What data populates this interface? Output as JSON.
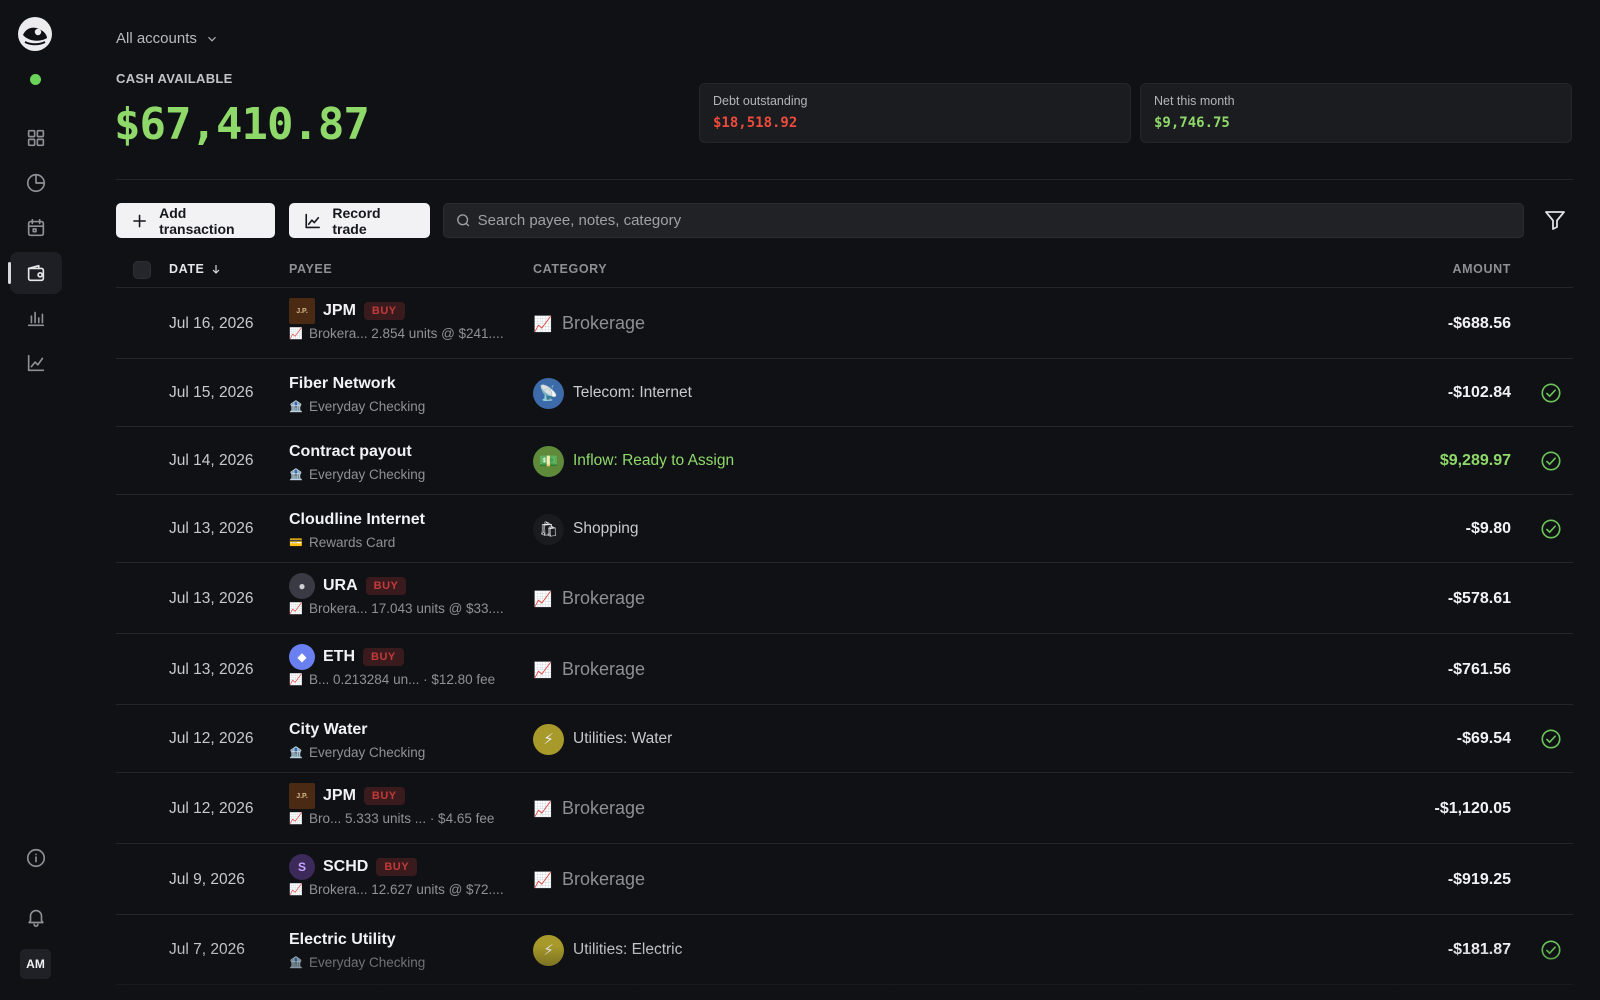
{
  "header": {
    "account_selector": "All accounts",
    "cash_label": "CASH AVAILABLE",
    "cash_value": "$67,410.87",
    "debt": {
      "label": "Debt outstanding",
      "value": "$18,518.92",
      "color": "#ef4b3c"
    },
    "net": {
      "label": "Net this month",
      "value": "$9,746.75",
      "color": "#8fd96a"
    }
  },
  "sidebar": {
    "status": "online",
    "items": [
      {
        "icon": "grid-icon"
      },
      {
        "icon": "pie-chart-icon"
      },
      {
        "icon": "calendar-icon"
      },
      {
        "icon": "wallet-icon",
        "active": true
      },
      {
        "icon": "bar-chart-icon"
      },
      {
        "icon": "line-chart-icon"
      }
    ],
    "bottom": [
      "info-icon",
      "bell-icon"
    ],
    "avatar": "AM"
  },
  "toolbar": {
    "add_label": "Add transaction",
    "trade_label": "Record trade",
    "search_placeholder": "Search payee, notes, category"
  },
  "table": {
    "headers": {
      "date": "DATE",
      "payee": "PAYEE",
      "category": "CATEGORY",
      "amount": "AMOUNT"
    },
    "rows": [
      {
        "date": "Jul 16, 2026",
        "payee": "JPM",
        "badge": "BUY",
        "sub_icon": "📈",
        "sub": "Brokera...  2.854 units @ $241....",
        "category": "Brokerage",
        "cat_icon": "📈",
        "amount": "-$688.56",
        "cleared": false
      },
      {
        "date": "Jul 15, 2026",
        "payee": "Fiber Network",
        "badge": "",
        "sub_icon": "🏦",
        "sub": "Everyday Checking",
        "category": "Telecom: Internet",
        "cat_icon": "📡",
        "amount": "-$102.84",
        "cleared": true
      },
      {
        "date": "Jul 14, 2026",
        "payee": "Contract payout",
        "badge": "",
        "sub_icon": "🏦",
        "sub": "Everyday Checking",
        "category": "Inflow: Ready to Assign",
        "cat_icon": "💵",
        "amount": "$9,289.97",
        "cleared": true
      },
      {
        "date": "Jul 13, 2026",
        "payee": "Cloudline Internet",
        "badge": "",
        "sub_icon": "💳",
        "sub": "Rewards Card",
        "category": "Shopping",
        "cat_icon": "🛍",
        "amount": "-$9.80",
        "cleared": true
      },
      {
        "date": "Jul 13, 2026",
        "payee": "URA",
        "badge": "BUY",
        "sub_icon": "📈",
        "sub": "Brokera...  17.043 units @ $33....",
        "category": "Brokerage",
        "cat_icon": "📈",
        "amount": "-$578.61",
        "cleared": false
      },
      {
        "date": "Jul 13, 2026",
        "payee": "ETH",
        "badge": "BUY",
        "sub_icon": "📈",
        "sub": "B...  0.213284 un...  · $12.80 fee",
        "category": "Brokerage",
        "cat_icon": "📈",
        "amount": "-$761.56",
        "cleared": false
      },
      {
        "date": "Jul 12, 2026",
        "payee": "City Water",
        "badge": "",
        "sub_icon": "🏦",
        "sub": "Everyday Checking",
        "category": "Utilities: Water",
        "cat_icon": "⚡",
        "amount": "-$69.54",
        "cleared": true
      },
      {
        "date": "Jul 12, 2026",
        "payee": "JPM",
        "badge": "BUY",
        "sub_icon": "📈",
        "sub": "Bro...  5.333 units ...  · $4.65 fee",
        "category": "Brokerage",
        "cat_icon": "📈",
        "amount": "-$1,120.05",
        "cleared": false
      },
      {
        "date": "Jul 9, 2026",
        "payee": "SCHD",
        "badge": "BUY",
        "sub_icon": "📈",
        "sub": "Brokera...  12.627 units @ $72....",
        "category": "Brokerage",
        "cat_icon": "📈",
        "amount": "-$919.25",
        "cleared": false
      },
      {
        "date": "Jul 7, 2026",
        "payee": "Electric Utility",
        "badge": "",
        "sub_icon": "🏦",
        "sub": "Everyday Checking",
        "category": "Utilities: Electric",
        "cat_icon": "⚡",
        "amount": "-$181.87",
        "cleared": true
      }
    ],
    "ticker_logos": {
      "JPM": "J.P.Morgan",
      "URA": "●",
      "ETH": "◆",
      "SCHD": "S"
    }
  },
  "colors": {
    "accent_green": "#8fd96a",
    "debt_red": "#ef4b3c",
    "buy_red": "#c23a3a",
    "bg": "#101114"
  }
}
